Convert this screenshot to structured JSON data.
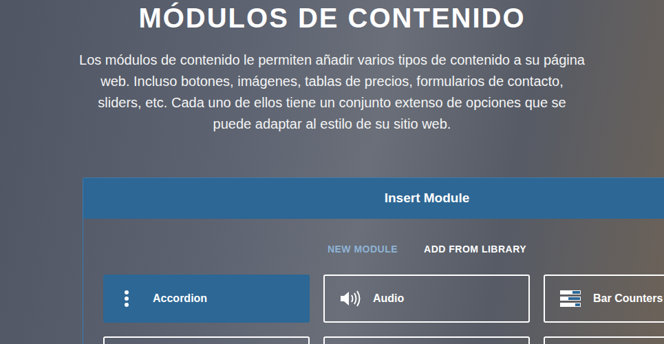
{
  "heading": "MÓDULOS DE CONTENIDO",
  "description": "Los módulos de contenido le permiten añadir varios tipos de contenido a su página web. Incluso botones, imágenes, tablas de precios, formularios de contacto, sliders, etc. Cada uno de ellos tiene un conjunto extenso de opciones que se puede adaptar al estilo de su sitio web.",
  "panel": {
    "title": "Insert Module",
    "tabs": [
      {
        "label": "NEW MODULE",
        "selected": true
      },
      {
        "label": "ADD FROM LIBRARY",
        "selected": false
      }
    ],
    "modules": [
      {
        "label": "Accordion",
        "selected": true
      },
      {
        "label": "Audio",
        "selected": false
      },
      {
        "label": "Bar Counters",
        "selected": false
      }
    ]
  }
}
